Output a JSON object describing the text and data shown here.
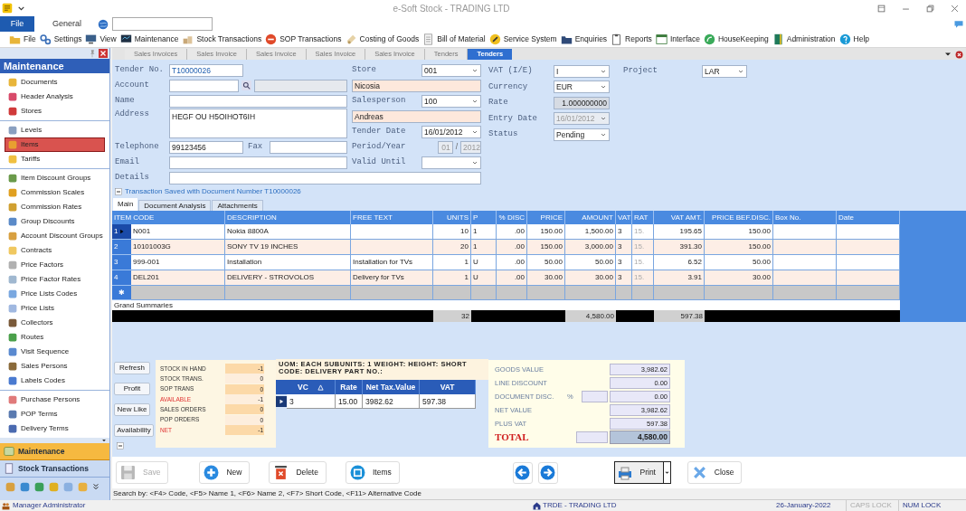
{
  "window": {
    "title": "e-Soft Stock - TRADING LTD"
  },
  "ribbon": {
    "file_button": "File",
    "tabs": [
      {
        "label": "General",
        "selected": true
      }
    ]
  },
  "toolbar": [
    "File",
    "Settings",
    "View",
    "Maintenance",
    "Stock Transactions",
    "SOP Transactions",
    "Costing of Goods",
    "Bill of Material",
    "Service System",
    "Enquiries",
    "Reports",
    "Interface",
    "HouseKeeping",
    "Administration",
    "Help"
  ],
  "sidebar": {
    "title": "Maintenance",
    "groups": [
      [
        {
          "label": "Documents",
          "selected": false
        },
        {
          "label": "Header Analysis",
          "selected": false
        },
        {
          "label": "Stores",
          "selected": false
        }
      ],
      [
        {
          "label": "Levels",
          "selected": false
        },
        {
          "label": "Items",
          "selected": true
        },
        {
          "label": "Tariffs",
          "selected": false
        }
      ],
      [
        {
          "label": "Item Discount Groups",
          "selected": false
        },
        {
          "label": "Commission Scales",
          "selected": false
        },
        {
          "label": "Commission Rates",
          "selected": false
        },
        {
          "label": "Group Discounts",
          "selected": false
        },
        {
          "label": "Account Discount Groups",
          "selected": false
        },
        {
          "label": "Contracts",
          "selected": false
        },
        {
          "label": "Price Factors",
          "selected": false
        },
        {
          "label": "Price Factor Rates",
          "selected": false
        },
        {
          "label": "Price Lists Codes",
          "selected": false
        },
        {
          "label": "Price Lists",
          "selected": false
        },
        {
          "label": "Collectors",
          "selected": false
        },
        {
          "label": "Routes",
          "selected": false
        },
        {
          "label": "Visit Sequence",
          "selected": false
        },
        {
          "label": "Sales Persons",
          "selected": false
        },
        {
          "label": "Labels Codes",
          "selected": false
        }
      ],
      [
        {
          "label": "Purchase Persons",
          "selected": false
        },
        {
          "label": "POP Terms",
          "selected": false
        },
        {
          "label": "Delivery Terms",
          "selected": false
        }
      ]
    ],
    "sections": [
      {
        "label": "Maintenance",
        "selected": true
      },
      {
        "label": "Stock Transactions",
        "selected": false
      }
    ]
  },
  "document_tabs": [
    {
      "label": "Sales Invoices",
      "selected": false
    },
    {
      "label": "Sales Invoice",
      "selected": false
    },
    {
      "label": "Sales Invoice",
      "selected": false
    },
    {
      "label": "Sales Invoice",
      "selected": false
    },
    {
      "label": "Sales Invoice",
      "selected": false
    },
    {
      "label": "Tenders",
      "selected": false
    },
    {
      "label": "Tenders",
      "selected": true
    }
  ],
  "form": {
    "left": [
      {
        "label": "Tender No.",
        "value": "T10000026",
        "kind": "code"
      },
      {
        "label": "Account",
        "kind": "lookup"
      },
      {
        "label": "Name",
        "kind": "text"
      },
      {
        "label": "Address",
        "value": "HEGF OU H5OIHOT6IH",
        "kind": "multiline"
      },
      {
        "label": "Telephone",
        "value": "99123456",
        "kind": "phone",
        "extra_label": "Fax"
      },
      {
        "label": "Email",
        "kind": "text"
      }
    ],
    "middle": [
      {
        "label": "Store",
        "value": "001",
        "kind": "select",
        "disabled": false
      },
      {
        "value": "Nicosia",
        "kind": "readonly",
        "disabled": false
      },
      {
        "label": "Salesperson",
        "value": "100",
        "kind": "select",
        "disabled": false
      },
      {
        "value": "Andreas",
        "kind": "readonly",
        "disabled": false
      },
      {
        "label": "Tender Date",
        "value": "16/01/2012",
        "kind": "select",
        "disabled": false
      },
      {
        "label": "Period/Year",
        "kind": "period",
        "values": [
          "01",
          "2012"
        ],
        "separator": "/",
        "disabled": true
      },
      {
        "label": "Valid Until",
        "kind": "select",
        "disabled": false
      }
    ],
    "details": {
      "label": "Details"
    },
    "right": [
      {
        "label": "VAT (I/E)",
        "value": "I",
        "kind": "select",
        "disabled": false
      },
      {
        "label": "Currency",
        "value": "EUR",
        "kind": "select",
        "disabled": false
      },
      {
        "label": "Rate",
        "value": "1.000000000",
        "kind": "number",
        "disabled": false
      },
      {
        "label": "Entry Date",
        "value": "16/01/2012",
        "kind": "select",
        "disabled": true
      },
      {
        "label": "Status",
        "value": "Pending",
        "kind": "select",
        "disabled": false
      }
    ],
    "project": {
      "label": "Project",
      "value": "LAR"
    }
  },
  "message": "Transaction Saved with Document Number T10000026",
  "sub_tabs": [
    {
      "label": "Main",
      "selected": true
    },
    {
      "label": "Document Analysis",
      "selected": false
    },
    {
      "label": "Attachments",
      "selected": false
    }
  ],
  "grid": {
    "columns": [
      "ITEM CODE",
      "DESCRIPTION",
      "FREE TEXT",
      "UNITS",
      "P",
      "% DISC",
      "PRICE",
      "AMOUNT",
      "VAT",
      "RAT",
      "VAT AMT.",
      "PRICE BEF.DISC.",
      "Box No.",
      "Date"
    ],
    "rows": [
      {
        "number": "1",
        "selected": true,
        "cells": [
          "N001",
          "Nokia 8800A",
          null,
          "10",
          "1",
          ".00",
          "150.00",
          "1,500.00",
          "3",
          "15.",
          "195.65",
          "150.00",
          null,
          null
        ]
      },
      {
        "number": "2",
        "selected": false,
        "cells": [
          "10101003G",
          "SONY TV 19 INCHES",
          null,
          "20",
          "1",
          ".00",
          "150.00",
          "3,000.00",
          "3",
          "15.",
          "391.30",
          "150.00",
          null,
          null
        ]
      },
      {
        "number": "3",
        "selected": false,
        "cells": [
          "999-001",
          "Installation",
          "Installation for TVs",
          "1",
          "U",
          ".00",
          "50.00",
          "50.00",
          "3",
          "15.",
          "6.52",
          "50.00",
          null,
          null
        ]
      },
      {
        "number": "4",
        "selected": false,
        "cells": [
          "DEL201",
          "DELIVERY - STROVOLOS",
          "Delivery for TVs",
          "1",
          "U",
          ".00",
          "30.00",
          "30.00",
          "3",
          "15.",
          "3.91",
          "30.00",
          null,
          null
        ]
      }
    ],
    "new_row_marker": "✱",
    "summary_label": "Grand Summaries",
    "totals": {
      "units": "32",
      "amount": "4,580.00",
      "vat_amount": "597.38"
    }
  },
  "side_buttons": [
    "Refresh",
    "Profit",
    "New Like",
    "Availability"
  ],
  "stock": [
    {
      "label": "STOCK IN HAND",
      "value": "-1",
      "alert": false
    },
    {
      "label": "STOCK TRANS.",
      "value": "0",
      "alert": false
    },
    {
      "label": "SOP TRANS",
      "value": "0",
      "alert": false
    },
    {
      "label": "AVAILABLE",
      "value": "-1",
      "alert": true
    },
    {
      "label": "SALES ORDERS",
      "value": "0",
      "alert": false
    },
    {
      "label": "POP ORDERS",
      "value": "0",
      "alert": false
    },
    {
      "label": "NET",
      "value": "-1",
      "alert": true
    }
  ],
  "item_info": "UOM: EACH SUBUNITS: 1 WEIGHT:  HEIGHT:  SHORT CODE: DELIVERY PART NO.:",
  "vat_table": {
    "columns": [
      "VC",
      "Rate",
      "Net Tax.Value",
      "VAT"
    ],
    "rows": [
      [
        "3",
        "15.00",
        "3982.62",
        "597.38"
      ]
    ]
  },
  "totals": [
    {
      "label": "GOODS VALUE",
      "value": "3,982.62",
      "kind": "line"
    },
    {
      "label": "LINE DISCOUNT",
      "value": "0.00",
      "kind": "line"
    },
    {
      "label": "DOCUMENT DISC.",
      "percent_sign": "%",
      "value": "0.00",
      "kind": "percent"
    },
    {
      "label": "NET VALUE",
      "value": "3,982.62",
      "kind": "line"
    },
    {
      "label": "PLUS VAT",
      "value": "597.38",
      "kind": "line"
    },
    {
      "label": "TOTAL",
      "value": "4,580.00",
      "kind": "grand"
    }
  ],
  "actions": [
    {
      "label": "Save",
      "kind": "button",
      "disabled": true
    },
    {
      "label": "New",
      "kind": "button",
      "disabled": false
    },
    {
      "label": "Delete",
      "kind": "button",
      "disabled": false
    },
    {
      "label": "Items",
      "kind": "button",
      "disabled": false
    },
    {
      "kind": "back",
      "disabled": false
    },
    {
      "kind": "forward",
      "disabled": false
    },
    {
      "label": "Print",
      "kind": "split",
      "disabled": false
    },
    {
      "label": "Close",
      "kind": "button",
      "disabled": false
    }
  ],
  "search_hint": "Search by: <F4> Code, <F5> Name 1, <F6> Name 2, <F7> Short Code, <F11> Alternative Code",
  "status_bar": {
    "user": "Manager Administrator",
    "company": "TRDE - TRADING LTD",
    "date": "26-January-2022",
    "indicators": [
      {
        "label": "CAPS LOCK",
        "on": false
      },
      {
        "label": "NUM LOCK",
        "on": true
      }
    ]
  }
}
